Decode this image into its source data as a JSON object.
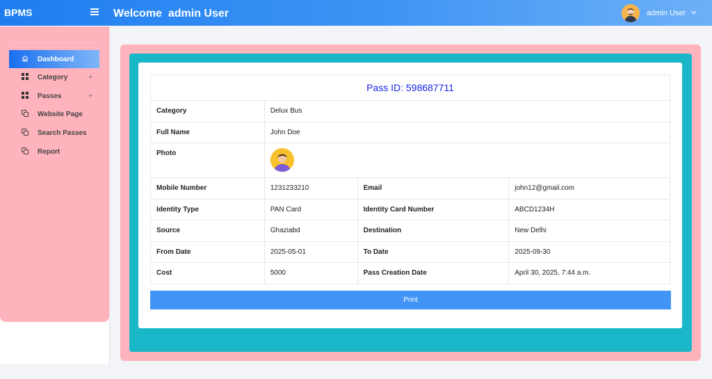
{
  "header": {
    "brand": "BPMS",
    "welcome": "Welcome  admin User",
    "user_name": "admin User",
    "menu_icon": "hamburger-icon",
    "caret_icon": "chevron-down-icon"
  },
  "sidebar": {
    "items": [
      {
        "label": "Dashboard",
        "icon": "home-icon",
        "active": true
      },
      {
        "label": "Category",
        "icon": "grid-icon",
        "expandable": "+"
      },
      {
        "label": "Passes",
        "icon": "grid-icon",
        "expandable": "+"
      },
      {
        "label": "Website Page",
        "icon": "copy-icon"
      },
      {
        "label": "Search Passes",
        "icon": "copy-icon"
      },
      {
        "label": "Report",
        "icon": "copy-icon"
      }
    ]
  },
  "pass": {
    "title": "Pass ID: 598687711",
    "category_label": "Category",
    "category_value": "Delux Bus",
    "fullname_label": "Full Name",
    "fullname_value": "John Doe",
    "photo_label": "Photo",
    "mobile_label": "Mobile Number",
    "mobile_value": "1231233210",
    "email_label": "Email",
    "email_value": "john12@gmail.com",
    "idtype_label": "Identity Type",
    "idtype_value": "PAN Card",
    "idnum_label": "Identity Card Number",
    "idnum_value": "ABCD1234H",
    "source_label": "Source",
    "source_value": "Ghaziabd",
    "destination_label": "Destination",
    "destination_value": "New Delhi",
    "from_label": "From Date",
    "from_value": "2025-05-01",
    "to_label": "To Date",
    "to_value": "2025-09-30",
    "cost_label": "Cost",
    "cost_value": "5000",
    "created_label": "Pass Creation Date",
    "created_value": "April 30, 2025, 7:44 a.m.",
    "print_label": "Print"
  },
  "colors": {
    "topbar_start": "#1e7ef0",
    "topbar_end": "#6db0f7",
    "sidebar_bg": "#ffb3bd",
    "frame_pink": "#ffb3bd",
    "frame_teal": "#1ab7c9",
    "title_text": "#1726e8",
    "print_button": "#4295f6"
  }
}
